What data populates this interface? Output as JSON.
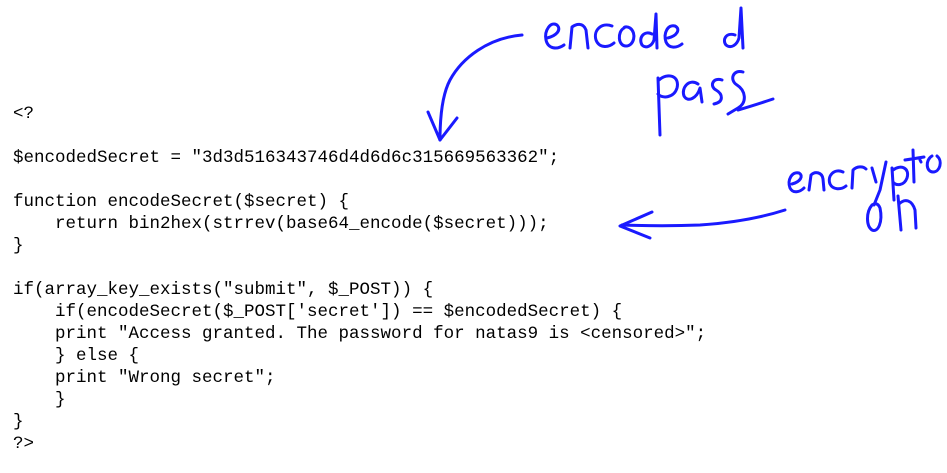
{
  "code_lines": [
    "<?",
    "",
    "$encodedSecret = \"3d3d516343746d4d6d6c315669563362\";",
    "",
    "function encodeSecret($secret) {",
    "    return bin2hex(strrev(base64_encode($secret)));",
    "}",
    "",
    "if(array_key_exists(\"submit\", $_POST)) {",
    "    if(encodeSecret($_POST['secret']) == $encodedSecret) {",
    "    print \"Access granted. The password for natas9 is <censored>\";",
    "    } else {",
    "    print \"Wrong secret\";",
    "    }",
    "}",
    "?>"
  ],
  "annotations": {
    "top_note": "encoded pass",
    "right_note": "encryption",
    "ink_color": "#1a1aff"
  }
}
